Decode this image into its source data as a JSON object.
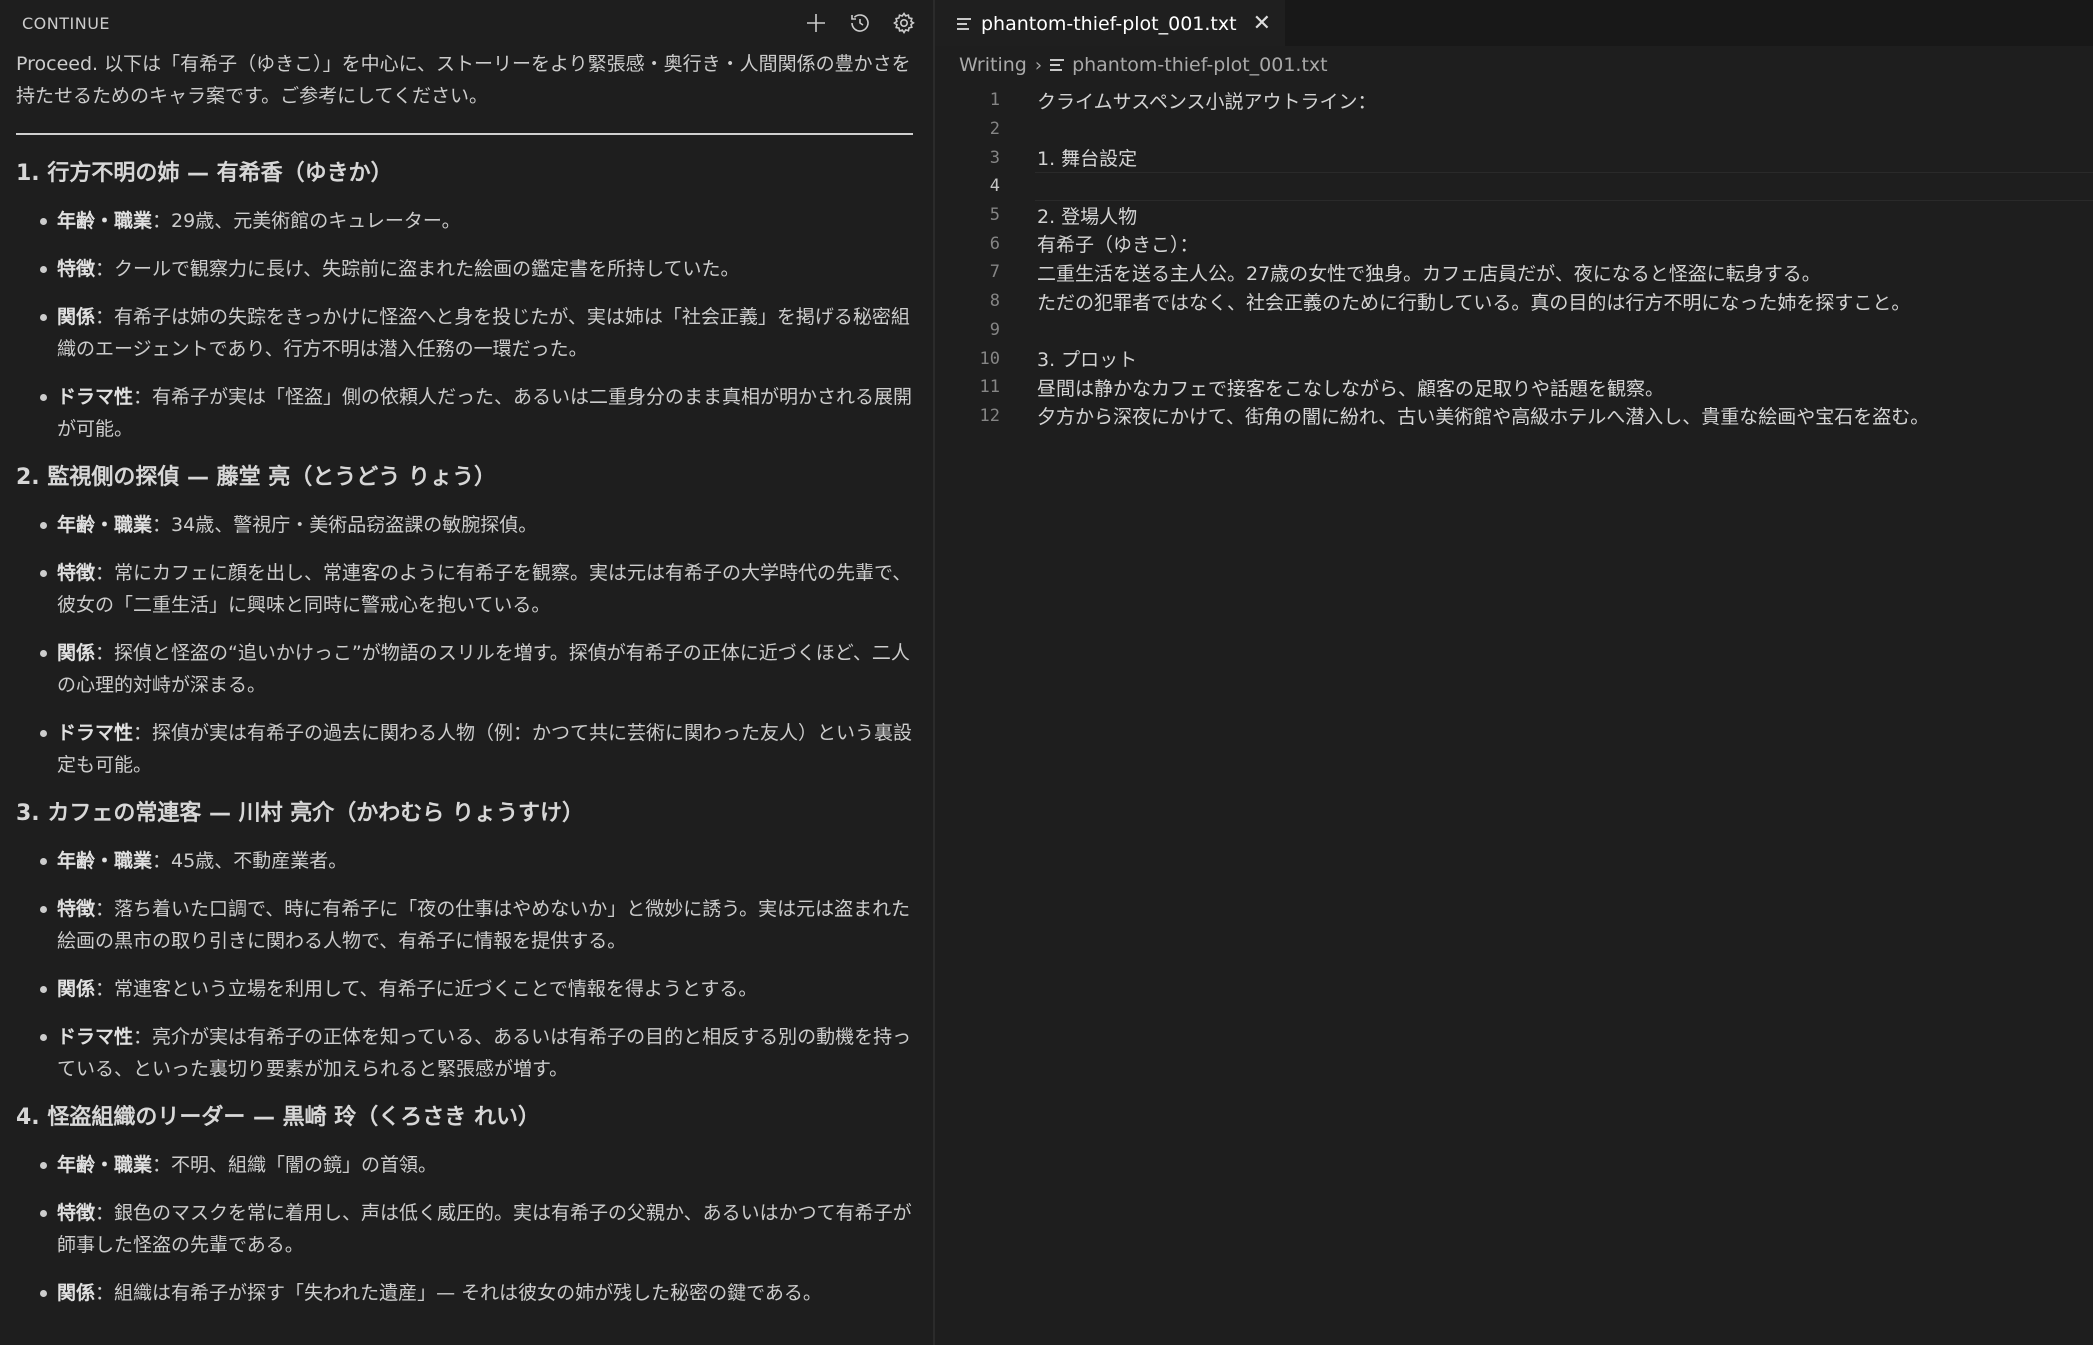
{
  "left_panel": {
    "title": "CONTINUE",
    "icons": [
      "plus-icon",
      "history-icon",
      "gear-icon"
    ],
    "intro": "Proceed. 以下は「有希子（ゆきこ）」を中心に、ストーリーをより緊張感・奥行き・人間関係の豊かさを持たせるためのキャラ案です。ご参考にしてください。",
    "sections": [
      {
        "title": "1. 行方不明の姉 — 有希香（ゆきか）",
        "items": [
          {
            "label": "年齢・職業",
            "text": "：29歳、元美術館のキュレーター。"
          },
          {
            "label": "特徴",
            "text": "：クールで観察力に長け、失踪前に盗まれた絵画の鑑定書を所持していた。"
          },
          {
            "label": "関係",
            "text": "：有希子は姉の失踪をきっかけに怪盗へと身を投じたが、実は姉は「社会正義」を掲げる秘密組織のエージェントであり、行方不明は潜入任務の一環だった。"
          },
          {
            "label": "ドラマ性",
            "text": "：有希子が実は「怪盗」側の依頼人だった、あるいは二重身分のまま真相が明かされる展開が可能。"
          }
        ]
      },
      {
        "title": "2. 監視側の探偵 — 藤堂 亮（とうどう りょう）",
        "items": [
          {
            "label": "年齢・職業",
            "text": "：34歳、警視庁・美術品窃盗課の敏腕探偵。"
          },
          {
            "label": "特徴",
            "text": "：常にカフェに顔を出し、常連客のように有希子を観察。実は元は有希子の大学時代の先輩で、彼女の「二重生活」に興味と同時に警戒心を抱いている。"
          },
          {
            "label": "関係",
            "text": "：探偵と怪盗の“追いかけっこ”が物語のスリルを増す。探偵が有希子の正体に近づくほど、二人の心理的対峙が深まる。"
          },
          {
            "label": "ドラマ性",
            "text": "：探偵が実は有希子の過去に関わる人物（例：かつて共に芸術に関わった友人）という裏設定も可能。"
          }
        ]
      },
      {
        "title": "3. カフェの常連客 — 川村 亮介（かわむら りょうすけ）",
        "items": [
          {
            "label": "年齢・職業",
            "text": "：45歳、不動産業者。"
          },
          {
            "label": "特徴",
            "text": "：落ち着いた口調で、時に有希子に「夜の仕事はやめないか」と微妙に誘う。実は元は盗まれた絵画の黒市の取り引きに関わる人物で、有希子に情報を提供する。"
          },
          {
            "label": "関係",
            "text": "：常連客という立場を利用して、有希子に近づくことで情報を得ようとする。"
          },
          {
            "label": "ドラマ性",
            "text": "：亮介が実は有希子の正体を知っている、あるいは有希子の目的と相反する別の動機を持っている、といった裏切り要素が加えられると緊張感が増す。"
          }
        ]
      },
      {
        "title": "4. 怪盗組織のリーダー — 黒崎 玲（くろさき れい）",
        "items": [
          {
            "label": "年齢・職業",
            "text": "：不明、組織「闇の鏡」の首領。"
          },
          {
            "label": "特徴",
            "text": "：銀色のマスクを常に着用し、声は低く威圧的。実は有希子の父親か、あるいはかつて有希子が師事した怪盗の先輩である。"
          },
          {
            "label": "関係",
            "text": "：組織は有希子が探す「失われた遺産」— それは彼女の姉が残した秘密の鍵である。"
          }
        ]
      }
    ]
  },
  "editor": {
    "tab": {
      "label": "phantom-thief-plot_001.txt",
      "icon": "file-lines-icon",
      "close_icon": "close-icon"
    },
    "breadcrumb": {
      "folder": "Writing",
      "file": "phantom-thief-plot_001.txt"
    },
    "current_line": 4,
    "lines": [
      {
        "n": "1",
        "text": "クライムサスペンス小説アウトライン："
      },
      {
        "n": "2",
        "text": ""
      },
      {
        "n": "3",
        "text": "1. 舞台設定"
      },
      {
        "n": "4",
        "text": ""
      },
      {
        "n": "5",
        "text": "2. 登場人物"
      },
      {
        "n": "6",
        "text": "有希子（ゆきこ）："
      },
      {
        "n": "7",
        "text": "二重生活を送る主人公。27歳の女性で独身。カフェ店員だが、夜になると怪盗に転身する。"
      },
      {
        "n": "8",
        "text": "ただの犯罪者ではなく、社会正義のために行動している。真の目的は行方不明になった姉を探すこと。"
      },
      {
        "n": "9",
        "text": ""
      },
      {
        "n": "10",
        "text": "3. プロット"
      },
      {
        "n": "11",
        "text": "昼間は静かなカフェで接客をこなしながら、顧客の足取りや話題を観察。"
      },
      {
        "n": "12",
        "text": "夕方から深夜にかけて、街角の闇に紛れ、古い美術館や高級ホテルへ潜入し、貴重な絵画や宝石を盗む。"
      }
    ]
  }
}
